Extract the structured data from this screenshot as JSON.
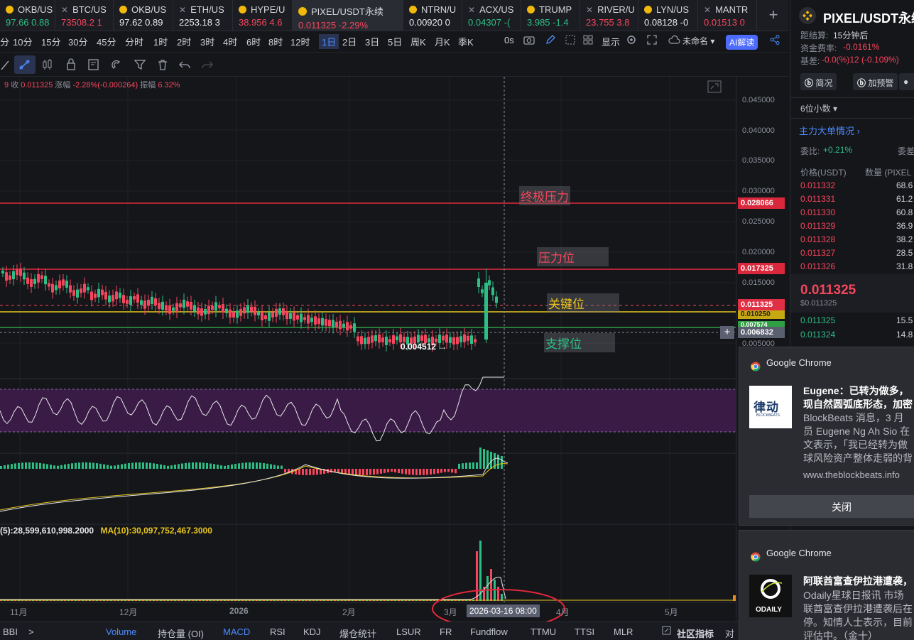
{
  "tabs": [
    {
      "name": "OKB/US",
      "price": "97.66",
      "chg": "0.88",
      "dir": "up"
    },
    {
      "name": "BTC/US",
      "price": "73508.2",
      "chg": "1",
      "dir": "dn"
    },
    {
      "name": "OKB/US",
      "price": "97.62",
      "chg": "0.89",
      "dir": "wt"
    },
    {
      "name": "ETH/US",
      "price": "2253.18",
      "chg": "3",
      "dir": "wt"
    },
    {
      "name": "HYPE/U",
      "price": "38.956",
      "chg": "4.6",
      "dir": "dn"
    },
    {
      "name": "PIXEL/USDT永续",
      "price": "0.011325",
      "chg": "-2.29%",
      "dir": "dn"
    },
    {
      "name": "NTRN/U",
      "price": "0.00920",
      "chg": "0",
      "dir": "wt"
    },
    {
      "name": "ACX/US",
      "price": "0.04307",
      "chg": "-(",
      "dir": "up"
    },
    {
      "name": "TRUMP",
      "price": "3.985",
      "chg": "-1.4",
      "dir": "up"
    },
    {
      "name": "RIVER/U",
      "price": "23.755",
      "chg": "3.8",
      "dir": "dn"
    },
    {
      "name": "LYN/US",
      "price": "0.08128",
      "chg": "-0",
      "dir": "wt"
    },
    {
      "name": "MANTR",
      "price": "0.01513",
      "chg": "0",
      "dir": "dn"
    }
  ],
  "add_tab": "+",
  "intervals": [
    "分",
    "10分",
    "15分",
    "30分",
    "45分",
    "分时",
    "1时",
    "2时",
    "3时",
    "4时",
    "6时",
    "8时",
    "12时",
    "1日",
    "2日",
    "3日",
    "5日",
    "周K",
    "月K",
    "季K"
  ],
  "selected_interval": "1日",
  "toolbar_right": {
    "countdown": "0s",
    "display": "显示",
    "layout": "未命名",
    "ai": "AI解读"
  },
  "ohlc_line": {
    "prefix": "9",
    "close_label": "收",
    "close": "0.011325",
    "chg_label": "涨幅",
    "chg": "-2.28%(-0.000264)",
    "amp_label": "振幅",
    "amp": "6.32%"
  },
  "price_axis": [
    "0.045000",
    "0.040000",
    "0.035000",
    "0.030000",
    "0.025000",
    "0.020000",
    "0.015000",
    "0.005000"
  ],
  "price_tags": {
    "ultimate": "0.028066",
    "pressure": "0.017325",
    "last": "0.011325",
    "key": "0.010250",
    "support": "0.007574",
    "cross": "0.006832"
  },
  "annotations": {
    "ultimate": "终极压力",
    "pressure": "压力位",
    "key": "关键位",
    "support": "支撑位",
    "low": "0.004512 →"
  },
  "volume_ma": {
    "ma5": "(5):28,599,610,998.2000",
    "ma10_label": "MA(10):",
    "ma10": "30,097,752,467.3000"
  },
  "time_axis": [
    "11月",
    "12月",
    "2026",
    "2月",
    "3月",
    "4月",
    "5月"
  ],
  "cursor_time": "2026-03-16 08:00",
  "indicator_tabs": [
    "BBI",
    ">",
    "Volume",
    "持仓量 (OI)",
    "MACD",
    "RSI",
    "KDJ",
    "爆仓统计",
    "LSUR",
    "FR",
    "Fundflow",
    "TTMU",
    "TTSI",
    "MLR",
    "社区指标",
    "对"
  ],
  "active_indicators": [
    "Volume",
    "MACD"
  ],
  "side": {
    "symbol": "PIXEL/USDT永续",
    "settle_label": "距结算:",
    "settle": "15分钟后",
    "funding_label": "资金费率:",
    "funding": "-0.0161%",
    "basis_label": "基差:",
    "basis": "-0.0(%)12 (-0.109%)",
    "btn_brief": "简况",
    "btn_alert": "加预警",
    "decimals": "6位小数",
    "flow": "主力大单情况",
    "ratio_label": "委比:",
    "ratio": "+0.21%",
    "ratio2": "委差",
    "col_price": "价格(USDT)",
    "col_qty": "数量 (PIXEL",
    "asks": [
      [
        "0.011332",
        "68.6"
      ],
      [
        "0.011331",
        "61.2"
      ],
      [
        "0.011330",
        "60.8"
      ],
      [
        "0.011329",
        "36.9"
      ],
      [
        "0.011328",
        "38.2"
      ],
      [
        "0.011327",
        "28.5"
      ],
      [
        "0.011326",
        "31.8"
      ]
    ],
    "last": "0.011325",
    "last_usd": "$0.011325",
    "bids": [
      [
        "0.011325",
        "15.5"
      ],
      [
        "0.011324",
        "14.8"
      ]
    ]
  },
  "notifications": [
    {
      "app": "Google Chrome",
      "title1": "Eugene：已转为做多，",
      "title2": "现自然圆弧底形态，加密",
      "body": [
        "BlockBeats 消息，3 月",
        "员 Eugene Ng Ah Sio 在",
        "文表示，「我已经转为做",
        "球风险资产整体走弱的背"
      ],
      "url": "www.theblockbeats.info",
      "close": "关闭",
      "logo": "律动",
      "logo_sub": "BLOCKBEATS"
    },
    {
      "app": "Google Chrome",
      "title1": "阿联酋富查伊拉港遭袭，",
      "body": [
        "Odaily星球日报讯 市场",
        "联酋富查伊拉港遭袭后在",
        "停。知情人士表示，目前",
        "评估中。（金十）"
      ],
      "logo": "ODAILY"
    }
  ],
  "colors": {
    "up": "#2ebd85",
    "down": "#f6465d",
    "accent": "#4d8cff",
    "yellow": "#e7c51c",
    "purple": "#3a1b45"
  }
}
